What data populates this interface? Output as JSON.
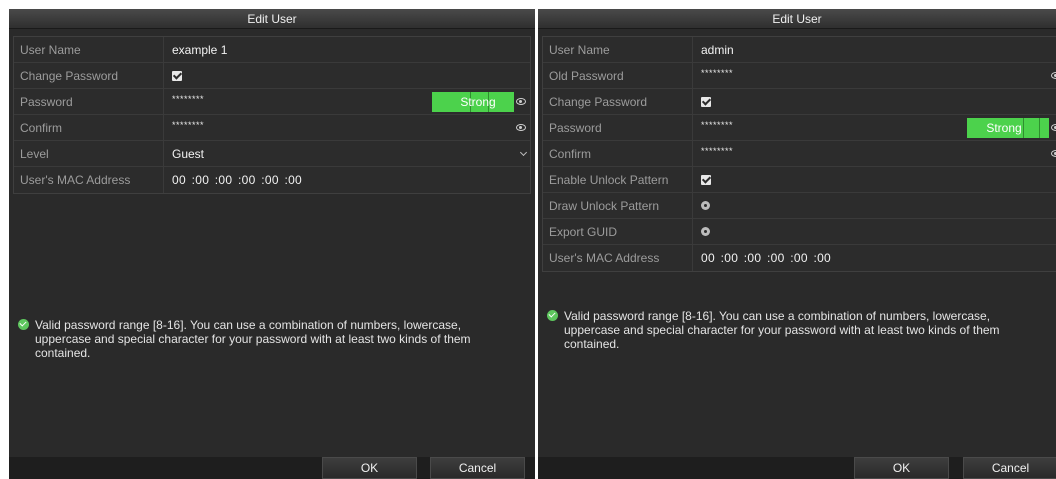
{
  "left_dialog": {
    "title": "Edit User",
    "rows": {
      "user_name": {
        "label": "User Name",
        "value": "example 1"
      },
      "change_password": {
        "label": "Change Password",
        "checked": true
      },
      "password": {
        "label": "Password",
        "value": "********",
        "strength": "Strong"
      },
      "confirm": {
        "label": "Confirm",
        "value": "********"
      },
      "level": {
        "label": "Level",
        "value": "Guest"
      },
      "mac": {
        "label": "User's MAC Address",
        "value": "00 :00 :00 :00 :00 :00"
      }
    },
    "hint": "Valid password range [8-16]. You can use a combination of numbers, lowercase, uppercase and special character for your password with at least two kinds of them contained.",
    "ok_label": "OK",
    "cancel_label": "Cancel"
  },
  "right_dialog": {
    "title": "Edit User",
    "rows": {
      "user_name": {
        "label": "User Name",
        "value": "admin"
      },
      "old_password": {
        "label": "Old Password",
        "value": "********"
      },
      "change_password": {
        "label": "Change Password",
        "checked": true
      },
      "password": {
        "label": "Password",
        "value": "********",
        "strength": "Strong"
      },
      "confirm": {
        "label": "Confirm",
        "value": "********"
      },
      "enable_unlock": {
        "label": "Enable Unlock Pattern",
        "checked": true
      },
      "draw_unlock": {
        "label": "Draw Unlock Pattern",
        "icon": "gear-icon"
      },
      "export_guid": {
        "label": "Export GUID",
        "icon": "gear-icon"
      },
      "mac": {
        "label": "User's MAC Address",
        "value": "00 :00 :00 :00 :00 :00"
      }
    },
    "hint": "Valid password range [8-16]. You can use a combination of numbers, lowercase, uppercase and special character for your password with at least two kinds of them contained.",
    "ok_label": "OK",
    "cancel_label": "Cancel"
  },
  "colors": {
    "strength_bar": "#4cd24c",
    "dialog_bg": "#2a2a2a",
    "ok_icon": "#5ec65e"
  }
}
